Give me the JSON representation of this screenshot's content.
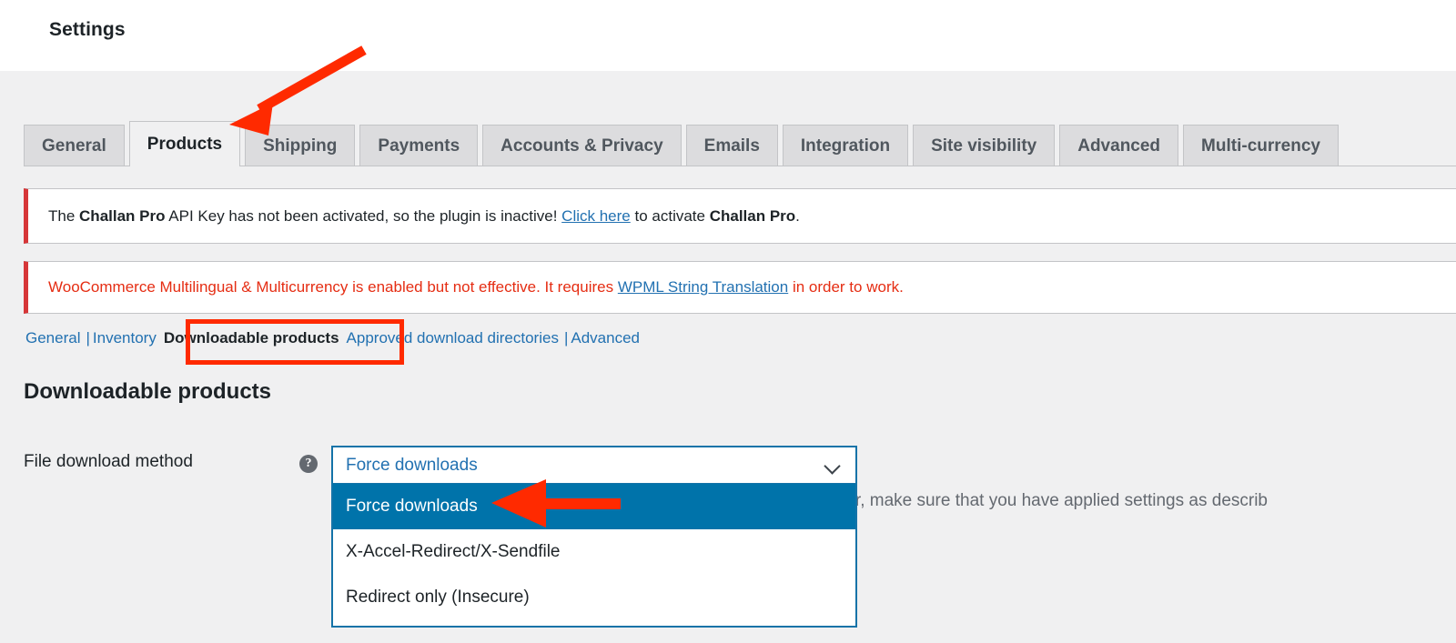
{
  "header": {
    "title": "Settings"
  },
  "tabs": [
    {
      "label": "General",
      "active": false
    },
    {
      "label": "Products",
      "active": true
    },
    {
      "label": "Shipping",
      "active": false
    },
    {
      "label": "Payments",
      "active": false
    },
    {
      "label": "Accounts & Privacy",
      "active": false
    },
    {
      "label": "Emails",
      "active": false
    },
    {
      "label": "Integration",
      "active": false
    },
    {
      "label": "Site visibility",
      "active": false
    },
    {
      "label": "Advanced",
      "active": false
    },
    {
      "label": "Multi-currency",
      "active": false
    }
  ],
  "notices": {
    "challan": {
      "part1": "The ",
      "strong1": "Challan Pro",
      "part2": " API Key has not been activated, so the plugin is inactive! ",
      "link": "Click here",
      "part3": " to activate ",
      "strong2": "Challan Pro",
      "part4": ".",
      "accent_color": "#d63638"
    },
    "wpml": {
      "part1": "WooCommerce Multilingual & Multicurrency is enabled but not effective. It requires ",
      "link": "WPML String Translation",
      "part2": " in order to work.",
      "text_color": "#e52d13",
      "accent_color": "#d63638"
    }
  },
  "subnav": {
    "items": [
      {
        "label": "General",
        "current": false
      },
      {
        "label": "Inventory",
        "current": false
      },
      {
        "label": "Downloadable products",
        "current": true
      },
      {
        "label": "Approved download directories",
        "current": false
      },
      {
        "label": "Advanced",
        "current": false
      }
    ],
    "separator": "|"
  },
  "section": {
    "title": "Downloadable products"
  },
  "form": {
    "file_download_method": {
      "label": "File download method",
      "help_icon": "help-circle-icon",
      "help_glyph": "?",
      "selected_value": "Force downloads",
      "chevron_icon": "chevron-down-icon",
      "options": [
        {
          "label": "Force downloads",
          "selected": true
        },
        {
          "label": "X-Accel-Redirect/X-Sendfile",
          "selected": false
        },
        {
          "label": "Redirect only (Insecure)",
          "selected": false
        }
      ],
      "description": "NGINX server, make sure that you have applied settings as describ"
    }
  },
  "annotations": {
    "arrow_color": "#ff2a00",
    "highlight_box_color": "#ff2a00",
    "arrow_to_products_tab": "arrow-pointing-to-products-tab",
    "arrow_to_force_downloads_option": "arrow-pointing-to-force-downloads-option"
  }
}
